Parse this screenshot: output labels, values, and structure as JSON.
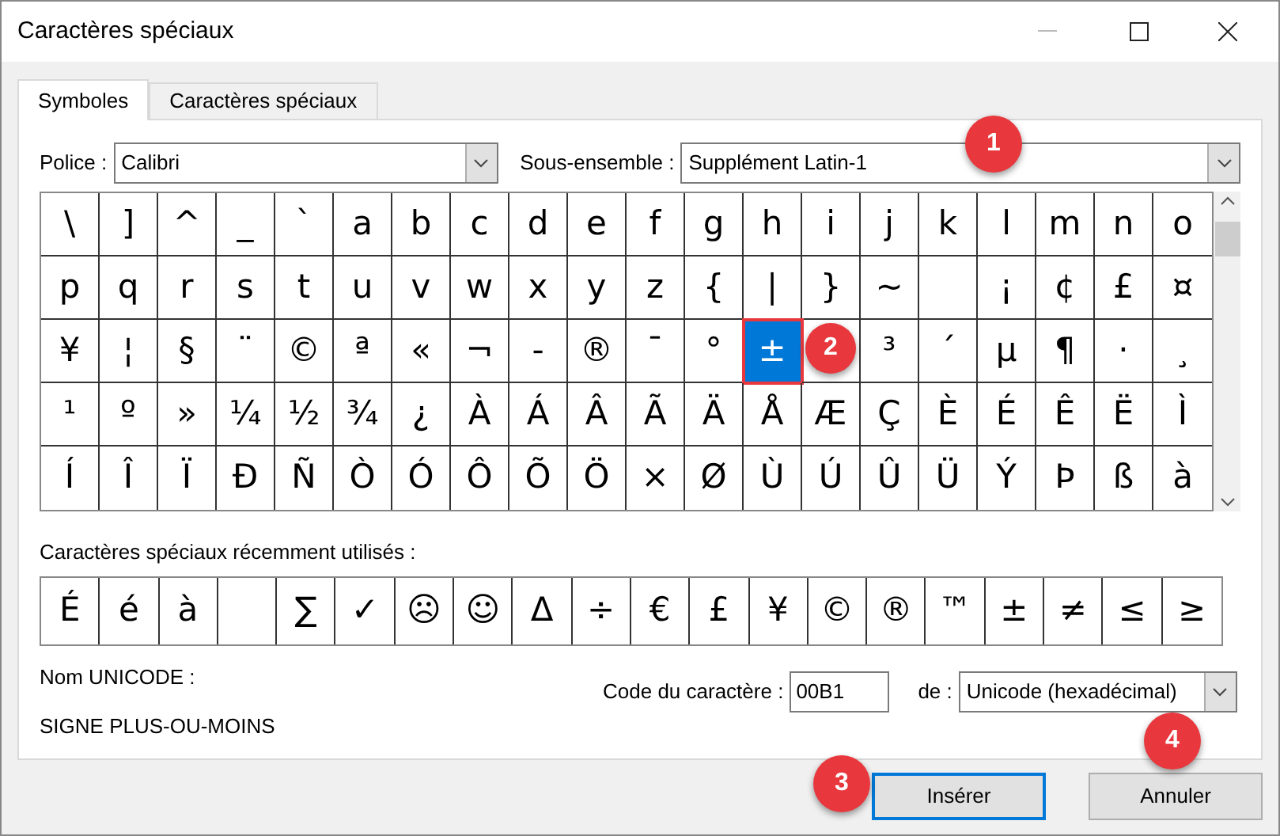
{
  "window": {
    "title": "Caractères spéciaux"
  },
  "tabs": [
    {
      "label": "Symboles",
      "selected": true
    },
    {
      "label": "Caractères spéciaux",
      "selected": false
    }
  ],
  "font_field": {
    "label": "Police :",
    "value": "Calibri"
  },
  "subset_field": {
    "label": "Sous-ensemble :",
    "value": "Supplément Latin-1"
  },
  "grid": {
    "rows": [
      [
        {
          "char": "\\",
          "selected": false
        },
        {
          "char": "]",
          "selected": false
        },
        {
          "char": "^",
          "selected": false
        },
        {
          "char": "_",
          "selected": false
        },
        {
          "char": "`",
          "selected": false
        },
        {
          "char": "a",
          "selected": false
        },
        {
          "char": "b",
          "selected": false
        },
        {
          "char": "c",
          "selected": false
        },
        {
          "char": "d",
          "selected": false
        },
        {
          "char": "e",
          "selected": false
        },
        {
          "char": "f",
          "selected": false
        },
        {
          "char": "g",
          "selected": false
        },
        {
          "char": "h",
          "selected": false
        },
        {
          "char": "i",
          "selected": false
        },
        {
          "char": "j",
          "selected": false
        },
        {
          "char": "k",
          "selected": false
        },
        {
          "char": "l",
          "selected": false
        },
        {
          "char": "m",
          "selected": false
        },
        {
          "char": "n",
          "selected": false
        },
        {
          "char": "o",
          "selected": false
        }
      ],
      [
        {
          "char": "p",
          "selected": false
        },
        {
          "char": "q",
          "selected": false
        },
        {
          "char": "r",
          "selected": false
        },
        {
          "char": "s",
          "selected": false
        },
        {
          "char": "t",
          "selected": false
        },
        {
          "char": "u",
          "selected": false
        },
        {
          "char": "v",
          "selected": false
        },
        {
          "char": "w",
          "selected": false
        },
        {
          "char": "x",
          "selected": false
        },
        {
          "char": "y",
          "selected": false
        },
        {
          "char": "z",
          "selected": false
        },
        {
          "char": "{",
          "selected": false
        },
        {
          "char": "|",
          "selected": false
        },
        {
          "char": "}",
          "selected": false
        },
        {
          "char": "~",
          "selected": false
        },
        {
          "selected": false
        },
        {
          "char": "¡",
          "selected": false
        },
        {
          "char": "¢",
          "selected": false
        },
        {
          "char": "£",
          "selected": false
        },
        {
          "char": "¤",
          "selected": false
        }
      ],
      [
        {
          "char": "¥",
          "selected": false
        },
        {
          "char": "¦",
          "selected": false
        },
        {
          "char": "§",
          "selected": false
        },
        {
          "char": "¨",
          "selected": false
        },
        {
          "char": "©",
          "selected": false
        },
        {
          "char": "ª",
          "selected": false
        },
        {
          "char": "«",
          "selected": false
        },
        {
          "char": "¬",
          "selected": false
        },
        {
          "char": "-",
          "selected": false
        },
        {
          "char": "®",
          "selected": false
        },
        {
          "char": "¯",
          "selected": false
        },
        {
          "char": "°",
          "selected": false
        },
        {
          "char": "±",
          "selected": true
        },
        {
          "selected": false
        },
        {
          "char": "³",
          "selected": false
        },
        {
          "char": "´",
          "selected": false
        },
        {
          "char": "µ",
          "selected": false
        },
        {
          "char": "¶",
          "selected": false
        },
        {
          "char": "·",
          "selected": false
        },
        {
          "char": "¸",
          "selected": false
        }
      ],
      [
        {
          "char": "¹",
          "selected": false
        },
        {
          "char": "º",
          "selected": false
        },
        {
          "char": "»",
          "selected": false
        },
        {
          "char": "¼",
          "selected": false
        },
        {
          "char": "½",
          "selected": false
        },
        {
          "char": "¾",
          "selected": false
        },
        {
          "char": "¿",
          "selected": false
        },
        {
          "char": "À",
          "selected": false
        },
        {
          "char": "Á",
          "selected": false
        },
        {
          "char": "Â",
          "selected": false
        },
        {
          "char": "Ã",
          "selected": false
        },
        {
          "char": "Ä",
          "selected": false
        },
        {
          "char": "Å",
          "selected": false
        },
        {
          "char": "Æ",
          "selected": false
        },
        {
          "char": "Ç",
          "selected": false
        },
        {
          "char": "È",
          "selected": false
        },
        {
          "char": "É",
          "selected": false
        },
        {
          "char": "Ê",
          "selected": false
        },
        {
          "char": "Ë",
          "selected": false
        },
        {
          "char": "Ì",
          "selected": false
        }
      ],
      [
        {
          "char": "Í",
          "selected": false
        },
        {
          "char": "Î",
          "selected": false
        },
        {
          "char": "Ï",
          "selected": false
        },
        {
          "char": "Ð",
          "selected": false
        },
        {
          "char": "Ñ",
          "selected": false
        },
        {
          "char": "Ò",
          "selected": false
        },
        {
          "char": "Ó",
          "selected": false
        },
        {
          "char": "Ô",
          "selected": false
        },
        {
          "char": "Õ",
          "selected": false
        },
        {
          "char": "Ö",
          "selected": false
        },
        {
          "char": "×",
          "selected": false
        },
        {
          "char": "Ø",
          "selected": false
        },
        {
          "char": "Ù",
          "selected": false
        },
        {
          "char": "Ú",
          "selected": false
        },
        {
          "char": "Û",
          "selected": false
        },
        {
          "char": "Ü",
          "selected": false
        },
        {
          "char": "Ý",
          "selected": false
        },
        {
          "char": "Þ",
          "selected": false
        },
        {
          "char": "ß",
          "selected": false
        },
        {
          "char": "à",
          "selected": false
        }
      ]
    ]
  },
  "recent": {
    "label": "Caractères spéciaux récemment utilisés :",
    "chars": [
      {
        "kind": "char",
        "char": "É"
      },
      {
        "kind": "char",
        "char": "é"
      },
      {
        "kind": "char",
        "char": "à"
      },
      {
        "kind": "blank"
      },
      {
        "kind": "char",
        "char": "∑"
      },
      {
        "kind": "char",
        "char": "✓"
      },
      {
        "kind": "char",
        "char": "☹"
      },
      {
        "kind": "char",
        "char": "☺"
      },
      {
        "kind": "char",
        "char": "Δ"
      },
      {
        "kind": "char",
        "char": "÷"
      },
      {
        "kind": "char",
        "char": "€"
      },
      {
        "kind": "char",
        "char": "£"
      },
      {
        "kind": "char",
        "char": "¥"
      },
      {
        "kind": "char",
        "char": "©"
      },
      {
        "kind": "char",
        "char": "®"
      },
      {
        "kind": "char",
        "char": "™"
      },
      {
        "kind": "char",
        "char": "±"
      },
      {
        "kind": "char",
        "char": "≠"
      },
      {
        "kind": "char",
        "char": "≤"
      },
      {
        "kind": "char",
        "char": "≥"
      }
    ]
  },
  "unicode_name": {
    "label": "Nom UNICODE :",
    "value": "SIGNE PLUS-OU-MOINS"
  },
  "char_code": {
    "label": "Code du caractère :",
    "value": "00B1"
  },
  "from_field": {
    "label": "de :",
    "value": "Unicode (hexadécimal)"
  },
  "buttons": [
    {
      "label": "Insérer",
      "kind": "default"
    },
    {
      "label": "Annuler",
      "kind": "normal"
    }
  ],
  "callouts": [
    "1",
    "2",
    "3",
    "4"
  ]
}
